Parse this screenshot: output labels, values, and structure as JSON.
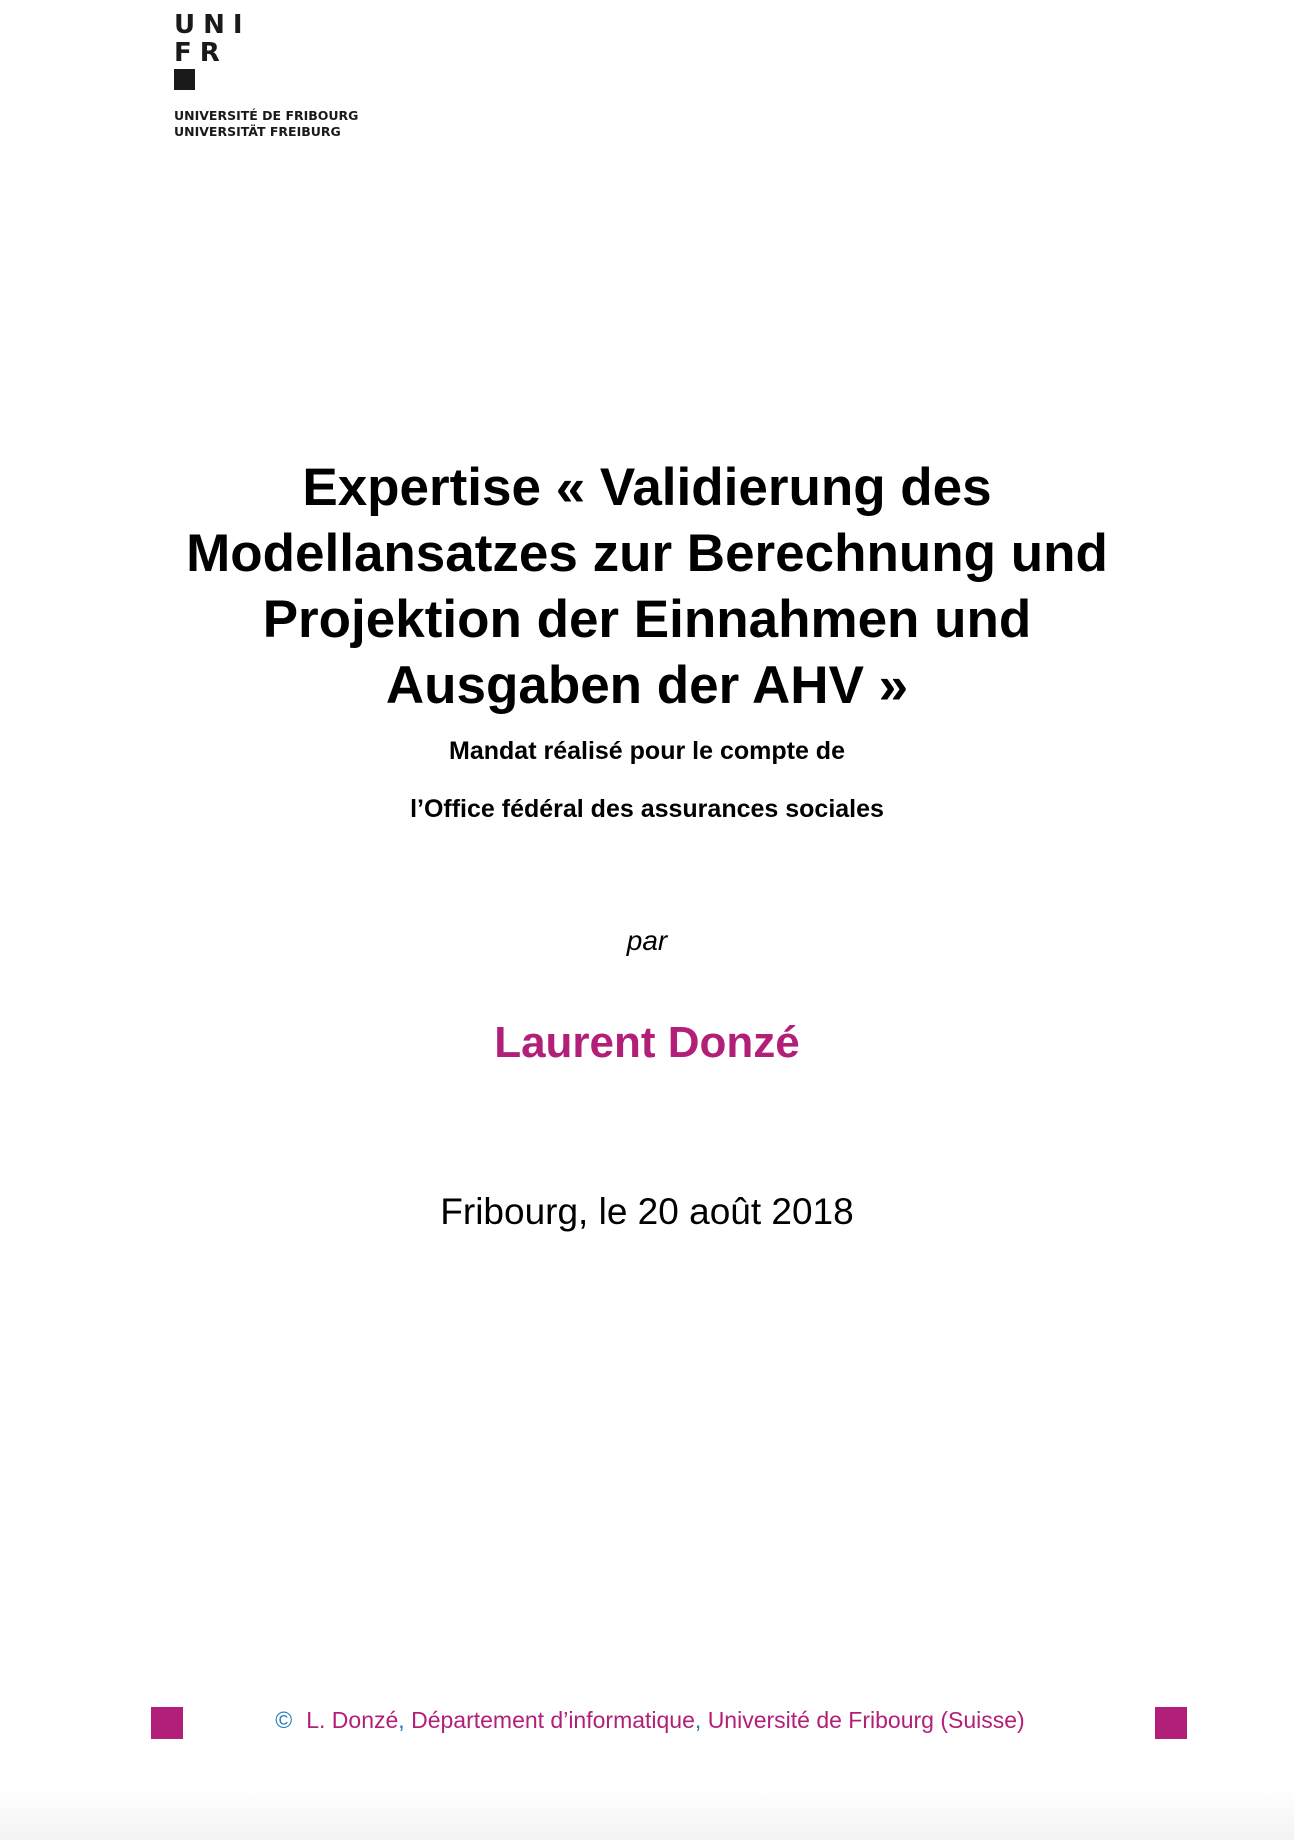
{
  "colors": {
    "accent": "#b21f78",
    "copyright_blue": "#1a7ab8",
    "text": "#000000",
    "logo": "#1a1a1a"
  },
  "logo": {
    "line1": "UNI",
    "line2": "FR",
    "name_fr": "UNIVERSITÉ DE FRIBOURG",
    "name_de": "UNIVERSITÄT FREIBURG"
  },
  "title": {
    "line1": "Expertise « Validierung des",
    "line2": "Modellansatzes zur Berechnung und",
    "line3": "Projektion der Einnahmen und",
    "line4": "Ausgaben der AHV »"
  },
  "subtitle": {
    "line1": "Mandat réalisé pour le compte de",
    "line2": "l’Office fédéral des assurances sociales"
  },
  "par": "par",
  "author": "Laurent Donzé",
  "date": "Fribourg, le 20 août 2018",
  "footer": {
    "copyright": "©",
    "name": "L. Donzé",
    "sep1": ",",
    "department": "Département d’informatique",
    "sep2": ",",
    "university": "Université de Fribourg (Suisse)"
  }
}
